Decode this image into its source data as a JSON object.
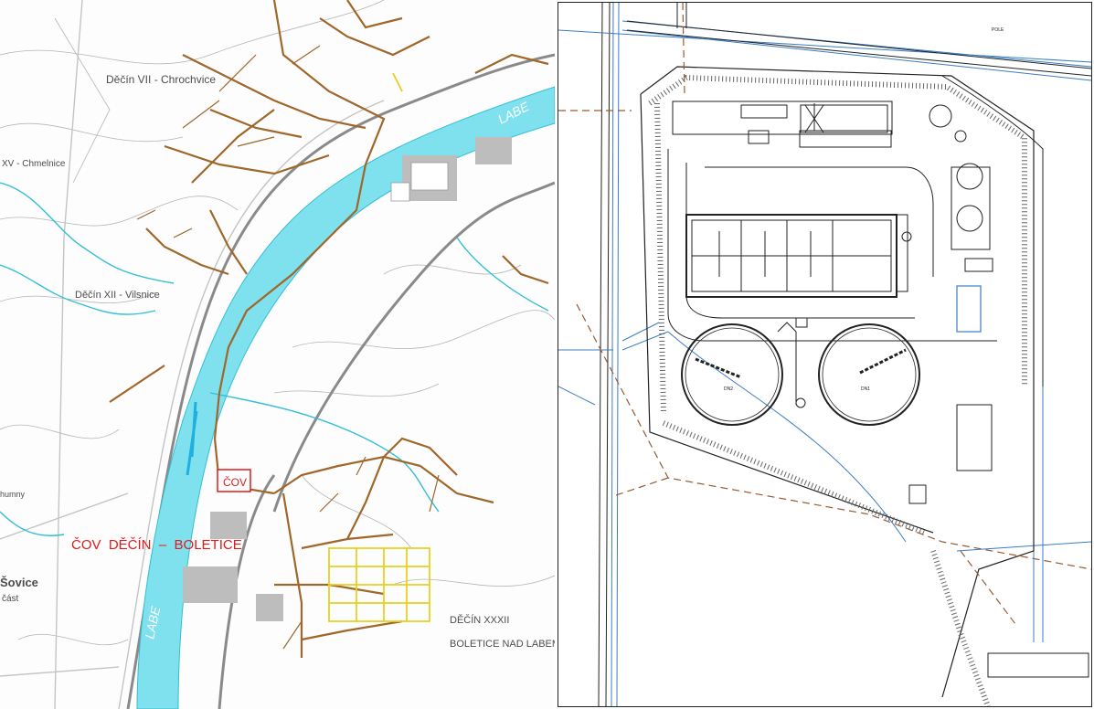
{
  "left_map": {
    "district_labels": [
      "Děčín VII - Chrochvice",
      "XV - Chmelnice",
      "Děčín XII - Vilsnice",
      "DĚČÍN XXXII",
      "BOLETICE NAD LABEM",
      "Šovice",
      "část",
      "humny"
    ],
    "river_labels": [
      "LABE",
      "LABE"
    ],
    "plant_box_label": "ČOV",
    "plant_title": "ČOV  DĚČÍN  –  BOLETICE",
    "colors": {
      "river": "#7fe0ee",
      "sewer": "#a0662a",
      "sewer_planned": "#e8d020",
      "plant": "#e01b1b",
      "terrain_line": "#9a9a9a"
    }
  },
  "right_plan": {
    "tank_labels": [
      "DN2",
      "DN1"
    ],
    "corner_label": "POLE",
    "colors": {
      "outline": "#222222",
      "utility": "#3a7cc4",
      "boundary": "#9a5a30"
    }
  }
}
